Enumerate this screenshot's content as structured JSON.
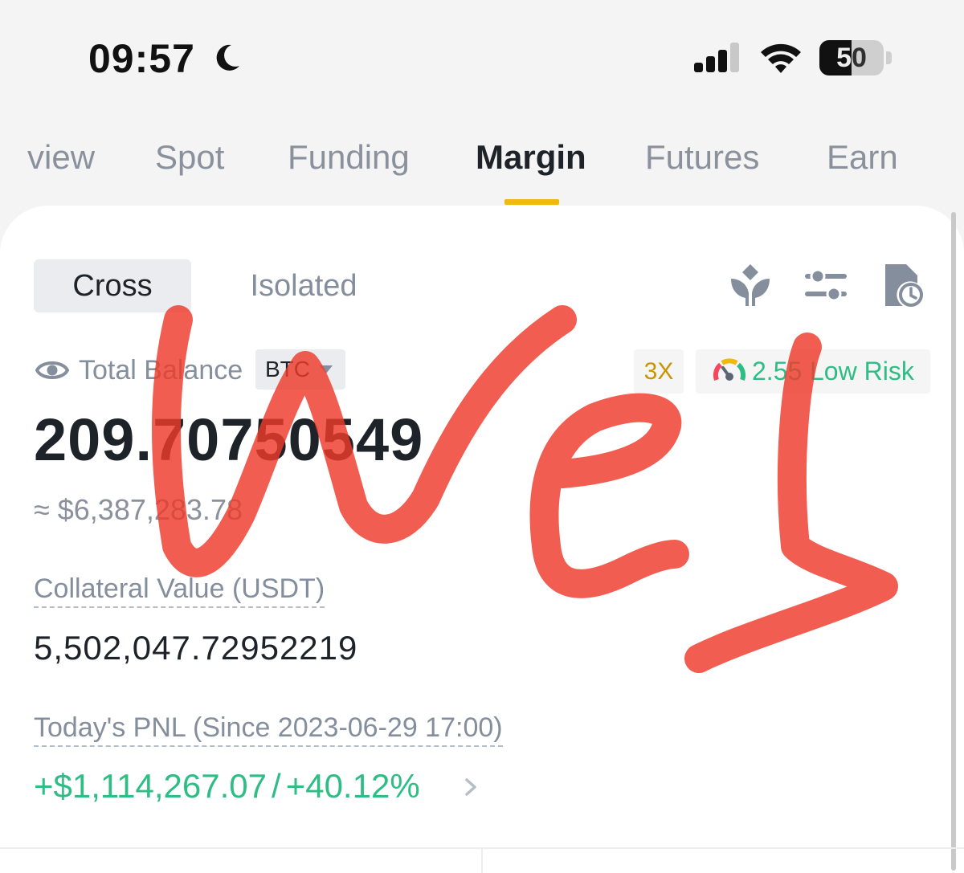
{
  "status_bar": {
    "time": "09:57",
    "battery": "50"
  },
  "tabs": [
    {
      "label": "view",
      "active": false
    },
    {
      "label": "Spot",
      "active": false
    },
    {
      "label": "Funding",
      "active": false
    },
    {
      "label": "Margin",
      "active": true
    },
    {
      "label": "Futures",
      "active": false
    },
    {
      "label": "Earn",
      "active": false
    }
  ],
  "account": {
    "mode_tabs": [
      {
        "label": "Cross",
        "active": true
      },
      {
        "label": "Isolated",
        "active": false
      }
    ],
    "balance_label": "Total Balance",
    "currency": "BTC",
    "leverage": "3X",
    "risk_value": "2.55",
    "risk_text": "Low Risk",
    "total_balance": "209.70750549",
    "usd_approx": "≈ $6,387,283.78",
    "collateral_label": "Collateral Value (USDT)",
    "collateral_value": "5,502,047.72952219",
    "pnl_label": "Today's PNL (Since 2023-06-29 17:00)",
    "pnl_amount": "+$1,114,267.07",
    "pnl_separator": "/",
    "pnl_percent": "+40.12%"
  },
  "colors": {
    "accent": "#f0b90b",
    "positive": "#2ebd85",
    "leverage": "#c99400",
    "scribble": "#ee3b2b"
  },
  "icons": [
    "moon-icon",
    "signal-icon",
    "wifi-icon",
    "battery-icon",
    "borrow-icon",
    "sliders-icon",
    "history-icon",
    "eye-icon",
    "caret-down-icon",
    "gauge-icon",
    "chevron-right-icon"
  ]
}
